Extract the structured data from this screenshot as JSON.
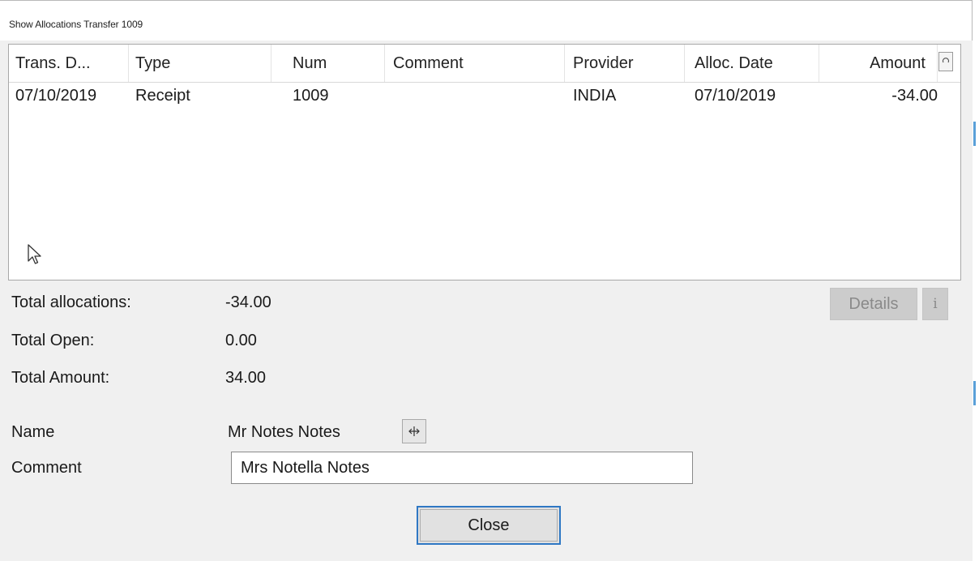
{
  "window": {
    "title": "Show Allocations Transfer 1009"
  },
  "list": {
    "columns": [
      "Trans. D...",
      "Type",
      "Num",
      "Comment",
      "Provider",
      "Alloc. Date",
      "Amount"
    ],
    "rows": [
      [
        "07/10/2019",
        "Receipt",
        "1009",
        "",
        "INDIA",
        "07/10/2019",
        "-34.00"
      ]
    ],
    "sort_icon": "sort-toggle-icon"
  },
  "totals": {
    "allocations_label": "Total allocations:",
    "allocations_value": "-34.00",
    "open_label": "Total Open:",
    "open_value": "0.00",
    "amount_label": "Total Amount:",
    "amount_value": "34.00"
  },
  "buttons": {
    "details": "Details",
    "info": "i",
    "close": "Close"
  },
  "name": {
    "label": "Name",
    "value": "Mr Notes Notes",
    "icon": "move-cursor-icon"
  },
  "comment": {
    "label": "Comment",
    "value": "Mrs Notella Notes"
  },
  "colors": {
    "focus_border": "#2f78c4",
    "disabled_button": "#cccccc",
    "window_bg": "#f0f0f0"
  }
}
